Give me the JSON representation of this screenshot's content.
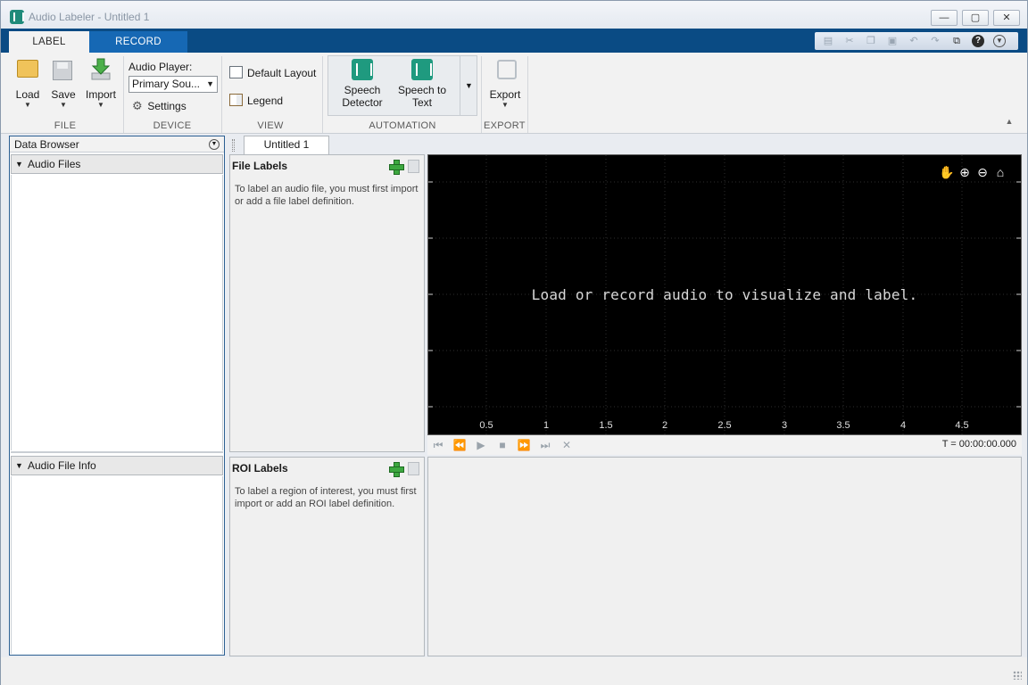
{
  "window": {
    "title": "Audio Labeler - Untitled 1",
    "minimize": "—",
    "maximize": "▢",
    "close": "✕"
  },
  "tabs": [
    {
      "label": "LABEL"
    },
    {
      "label": "RECORD"
    }
  ],
  "ribbon": {
    "file": {
      "load": "Load",
      "save": "Save",
      "import": "Import",
      "group": "FILE"
    },
    "device": {
      "player_label": "Audio Player:",
      "player_value": "Primary Sou...",
      "settings": "Settings",
      "group": "DEVICE"
    },
    "view": {
      "default_layout": "Default Layout",
      "legend": "Legend",
      "group": "VIEW"
    },
    "automation": {
      "speech_detector": "Speech Detector",
      "speech_to_text": "Speech to Text",
      "group": "AUTOMATION"
    },
    "export": {
      "label": "Export",
      "group": "EXPORT"
    }
  },
  "data_browser": {
    "title": "Data Browser",
    "audio_files": "Audio Files",
    "audio_file_info": "Audio File Info"
  },
  "document": {
    "tab": "Untitled 1"
  },
  "file_labels": {
    "title": "File Labels",
    "help": "To label an audio file, you must first import or add a file label definition."
  },
  "roi_labels": {
    "title": "ROI Labels",
    "help": "To label a region of interest, you must first import or add an ROI label definition."
  },
  "plot": {
    "message": "Load or record audio to visualize and label.",
    "x_ticks": [
      "0.5",
      "1",
      "1.5",
      "2",
      "2.5",
      "3",
      "3.5",
      "4",
      "4.5"
    ],
    "time_readout": "T = 00:00:00.000"
  },
  "colors": {
    "ribbon_tab_bar": "#0a4b84",
    "record_tab": "#1668b4",
    "plot_background": "#000000",
    "automation_icon": "#1f9a7f"
  }
}
